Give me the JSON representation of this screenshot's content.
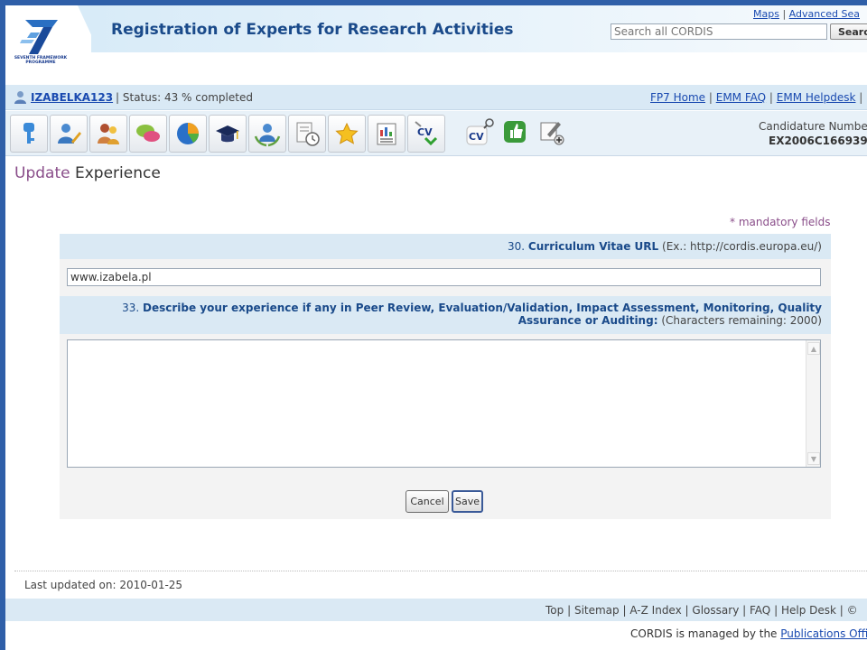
{
  "header": {
    "logo_text": "SEVENTH FRAMEWORK PROGRAMME",
    "title": "Registration of Experts for Research Activities",
    "top_links": [
      "Maps",
      "Advanced Sea"
    ],
    "search": {
      "placeholder": "Search all CORDIS",
      "button_label": "Searc"
    }
  },
  "user_bar": {
    "username": "IZABELKA123",
    "separator": "|",
    "status": "Status: 43 % completed",
    "links": [
      "FP7 Home",
      "EMM FAQ",
      "EMM Helpdesk"
    ]
  },
  "toolbar": {
    "icons": [
      "key-icon",
      "user-edit-icon",
      "users-icon",
      "chat-icon",
      "pie-chart-icon",
      "graduation-cap-icon",
      "group-award-icon",
      "document-clock-icon",
      "star-icon",
      "report-icon",
      "cv-download-icon",
      "cv-search-icon",
      "thumbs-up-icon",
      "edit-add-icon"
    ],
    "cv_label": "CV",
    "candidature_label": "Candidature Numbe",
    "candidature_number": "EX2006C166939"
  },
  "content": {
    "title_accent": "Update",
    "title_rest": " Experience",
    "mandatory_note": "* mandatory fields",
    "field30": {
      "number": "30.",
      "label": "Curriculum Vitae URL",
      "hint": "(Ex.: http://cordis.europa.eu/)",
      "value": "www.izabela.pl"
    },
    "field33": {
      "number": "33.",
      "label_line1": "Describe your experience if any in Peer Review, Evaluation/Validation, Impact Assessment, Monitoring, Quality",
      "label_line2": "Assurance or Auditing:",
      "hint": "(Characters remaining: 2000)",
      "value": ""
    },
    "buttons": {
      "cancel": "Cancel",
      "save": "Save"
    }
  },
  "footer": {
    "last_updated": "Last updated on: 2010-01-25",
    "links": [
      "Top",
      "Sitemap",
      "A-Z Index",
      "Glossary",
      "FAQ",
      "Help Desk"
    ],
    "trailing": "| ©",
    "managed_by": "CORDIS is managed by the ",
    "managed_link": "Publications Offi"
  },
  "colors": {
    "frame": "#2f5fa8",
    "title": "#1a4a8a",
    "link": "#1a4ab0",
    "accent": "#8a4e8a",
    "band": "#dae9f4"
  }
}
